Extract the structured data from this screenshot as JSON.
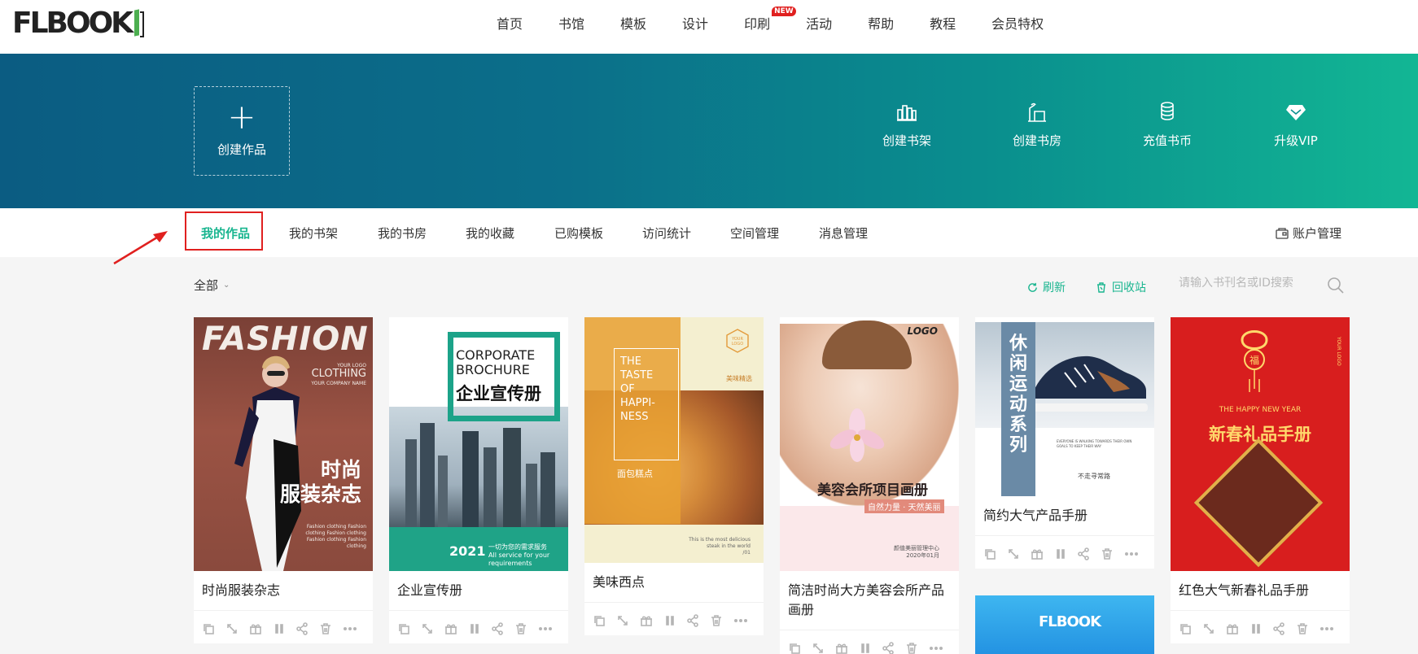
{
  "logo": {
    "text": "FLBOOK"
  },
  "nav": {
    "items": [
      "首页",
      "书馆",
      "模板",
      "设计",
      "印刷",
      "活动",
      "帮助",
      "教程",
      "会员特权"
    ],
    "new_badge": "NEW"
  },
  "banner": {
    "create": "创建作品",
    "actions": [
      {
        "label": "创建书架",
        "icon": "bookshelf-icon"
      },
      {
        "label": "创建书房",
        "icon": "study-room-icon"
      },
      {
        "label": "充值书币",
        "icon": "coins-icon"
      },
      {
        "label": "升级VIP",
        "icon": "diamond-icon"
      }
    ]
  },
  "tabs": {
    "items": [
      "我的作品",
      "我的书架",
      "我的书房",
      "我的收藏",
      "已购模板",
      "访问统计",
      "空间管理",
      "消息管理"
    ],
    "account": "账户管理"
  },
  "filter": {
    "all": "全部",
    "refresh": "刷新",
    "recycle": "回收站",
    "search_placeholder": "请输入书刊名或ID搜索"
  },
  "covers": {
    "fashion": {
      "big": "FASHION",
      "your_logo": "YOUR LOGO",
      "clothing": "CLOTHING",
      "company": "YOUR COMPANY NAME",
      "cn1": "时尚",
      "cn2": "服装杂志",
      "small": "Fashion clothing Fashion clothing Fashion clothing Fashion clothing Fashion clothing"
    },
    "corporate": {
      "en1": "CORPORATE",
      "en2": "BROCHURE",
      "cn": "企业宣传册",
      "year": "2021",
      "slogan1": "一切为您的需求服务",
      "slogan2": "All service for your requirements"
    },
    "pastry": {
      "ttl1": "THE",
      "ttl2": "TASTE",
      "ttl3": "OF",
      "ttl4": "HAPPI-",
      "ttl5": "NESS",
      "badge": "YOUR LOGO",
      "sub": "美味精选",
      "cn": "面包糕点",
      "foot1": "This is the most delicious",
      "foot2": "steak in the world",
      "foot3": "/01"
    },
    "beauty": {
      "logo": "LOGO",
      "cn": "美容会所项目画册",
      "tag": "自然力量 · 天然美丽",
      "ft1": "颜值美丽管理中心",
      "ft2": "2020年01月"
    },
    "shoe": {
      "cn": "休闲运动系列",
      "sub": "不走寻常路",
      "txt": "EVERYONE IS WALKING TOWARDS THEIR OWN GOALS TO KEEP THEIR WAY"
    },
    "newyear": {
      "fu": "福",
      "hny": "THE HAPPY NEW YEAR",
      "cn": "新春礼品手册",
      "side": "YOUR LOGO"
    },
    "blue": {
      "logo": "FLBOOK"
    }
  },
  "cards": [
    {
      "title": "时尚服装杂志"
    },
    {
      "title": "企业宣传册"
    },
    {
      "title": "美味西点"
    },
    {
      "title": "简洁时尚大方美容会所产品画册"
    },
    {
      "title": "简约大气产品手册"
    },
    {
      "title": "红色大气新春礼品手册"
    }
  ],
  "colors": {
    "accent": "#19b58f",
    "highlight": "#e0201f",
    "banner_start": "#0b5c82",
    "banner_end": "#12b694"
  }
}
